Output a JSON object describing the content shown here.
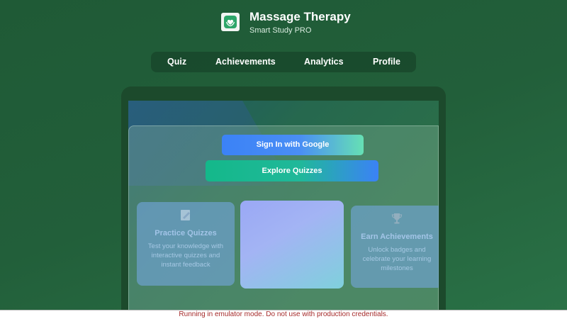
{
  "header": {
    "title": "Massage Therapy",
    "subtitle": "Smart Study PRO",
    "logo_icon": "hands-heart-icon"
  },
  "nav": {
    "items": [
      {
        "label": "Quiz"
      },
      {
        "label": "Achievements"
      },
      {
        "label": "Analytics"
      },
      {
        "label": "Profile"
      }
    ]
  },
  "main": {
    "sign_in_button": "Sign In with Google",
    "explore_button": "Explore Quizzes",
    "features": [
      {
        "icon": "pencil-memo-icon",
        "title": "Practice Quizzes",
        "text": "Test your knowledge with interactive quizzes and instant feedback"
      },
      {
        "icon": "",
        "title": "",
        "text": ""
      },
      {
        "icon": "trophy-icon",
        "title": "Earn Achievements",
        "text": "Unlock badges and celebrate your learning milestones"
      }
    ]
  },
  "banner": {
    "text": "Running in emulator mode. Do not use with production credentials."
  },
  "colors": {
    "background": "#225f3a",
    "google_gradient_start": "#3b82f6",
    "explore_gradient_start": "#14b88a",
    "banner_text": "#a52a2a"
  }
}
